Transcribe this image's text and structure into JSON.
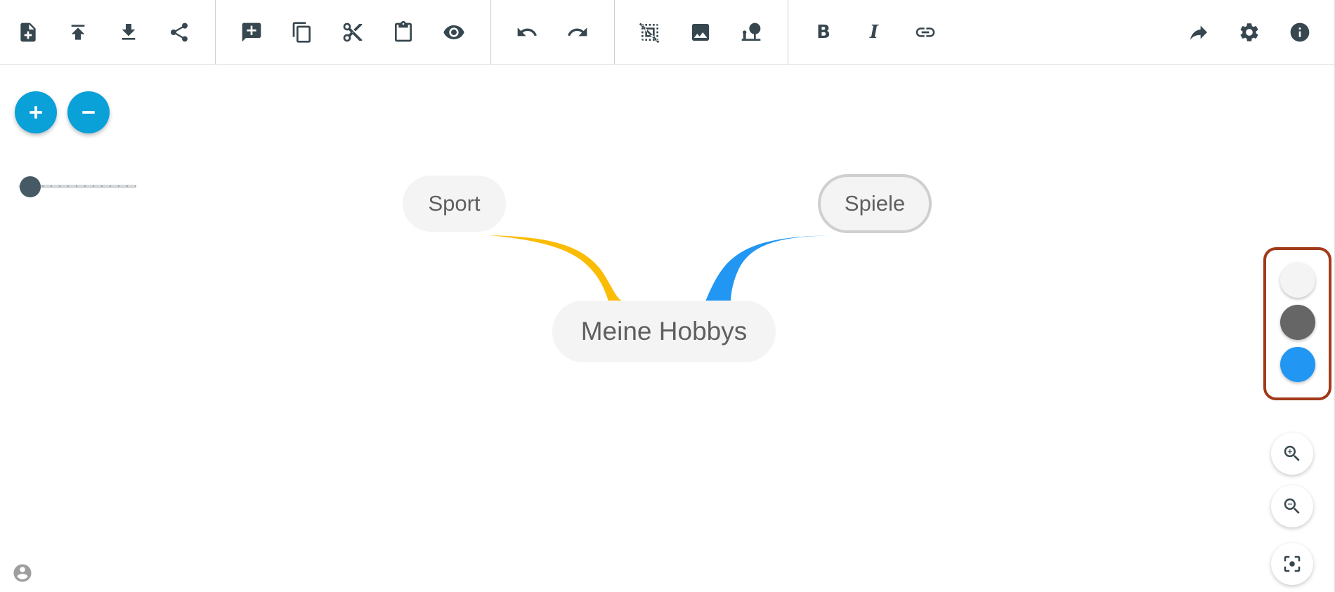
{
  "toolbar": {
    "buttons": [
      {
        "id": "new",
        "icon": "new-file-icon"
      },
      {
        "id": "upload",
        "icon": "upload-icon"
      },
      {
        "id": "download",
        "icon": "download-icon"
      },
      {
        "id": "share",
        "icon": "share-icon"
      },
      {
        "id": "add-comment",
        "icon": "add-comment-icon"
      },
      {
        "id": "copy",
        "icon": "copy-icon"
      },
      {
        "id": "cut",
        "icon": "scissors-icon"
      },
      {
        "id": "paste",
        "icon": "clipboard-icon"
      },
      {
        "id": "preview",
        "icon": "eye-icon"
      },
      {
        "id": "undo",
        "icon": "undo-icon"
      },
      {
        "id": "redo",
        "icon": "redo-icon"
      },
      {
        "id": "deselect",
        "icon": "deselect-icon"
      },
      {
        "id": "image",
        "icon": "image-icon"
      },
      {
        "id": "place",
        "icon": "place-item-icon"
      },
      {
        "id": "link",
        "icon": "link-icon"
      },
      {
        "id": "forward",
        "icon": "forward-icon"
      },
      {
        "id": "settings",
        "icon": "gear-icon"
      },
      {
        "id": "info",
        "icon": "info-icon"
      }
    ],
    "bold_label": "B",
    "italic_label": "I"
  },
  "mindmap": {
    "root": "Meine Hobbys",
    "children": [
      {
        "label": "Sport",
        "branch_color": "#fbbc05",
        "side": "left"
      },
      {
        "label": "Spiele",
        "branch_color": "#2196f3",
        "side": "right",
        "selected": true
      }
    ]
  },
  "colors": {
    "accent": "#0aa0d8",
    "icon": "#37474f",
    "highlight_border": "#a23a1a"
  },
  "color_picker": {
    "swatches": [
      {
        "name": "light-gray",
        "color": "#f4f4f4"
      },
      {
        "name": "dark-gray",
        "color": "#666666"
      },
      {
        "name": "blue",
        "color": "#2196f3"
      }
    ]
  },
  "zoom_slider": {
    "level": 0
  }
}
